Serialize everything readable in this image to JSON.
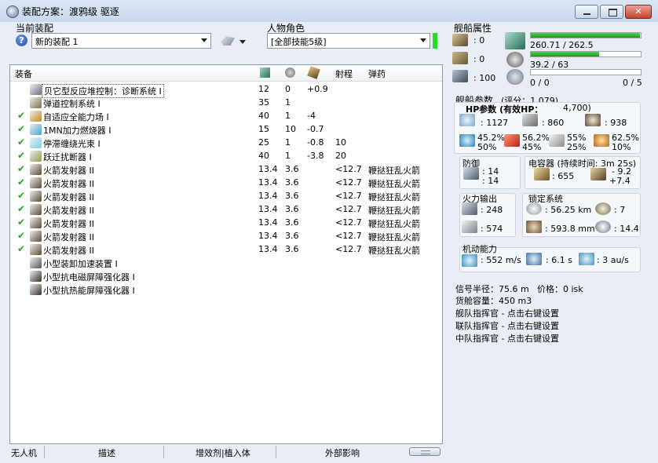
{
  "window": {
    "title": "装配方案：渡鸦级 驱逐"
  },
  "fitting_panel": {
    "label": "当前装配",
    "fit_select": "新的装配 1",
    "character_label": "人物角色",
    "character_select": "[全部技能5级]"
  },
  "module_list": {
    "headers": {
      "equip": "装备",
      "range": "射程",
      "ammo": "弹药"
    },
    "rows": [
      {
        "checked": false,
        "name": "贝它型反应堆控制：诊断系统 I",
        "c1": "12",
        "c2": "0",
        "c3": "+0.9",
        "range": "",
        "ammo": "",
        "icon": "#6e6e7e"
      },
      {
        "checked": false,
        "name": "弹道控制系统 I",
        "c1": "35",
        "c2": "1",
        "c3": "",
        "range": "",
        "ammo": "",
        "icon": "#7a6a4a"
      },
      {
        "checked": true,
        "name": "自适应全能力场 I",
        "c1": "40",
        "c2": "1",
        "c3": "-4",
        "range": "",
        "ammo": "",
        "icon": "#c4871e"
      },
      {
        "checked": true,
        "name": "1MN加力燃烧器 I",
        "c1": "15",
        "c2": "10",
        "c3": "-0.7",
        "range": "",
        "ammo": "",
        "icon": "#3fa7c9"
      },
      {
        "checked": true,
        "name": "停滞缠绕光束 I",
        "c1": "25",
        "c2": "1",
        "c3": "-0.8",
        "range": "10",
        "ammo": "",
        "icon": "#7fd0e8"
      },
      {
        "checked": true,
        "name": "跃迁扰断器 I",
        "c1": "40",
        "c2": "1",
        "c3": "-3.8",
        "range": "20",
        "ammo": "",
        "icon": "#8aa04a"
      },
      {
        "checked": true,
        "name": "火箭发射器 II",
        "c1": "13.4",
        "c2": "3.6",
        "c3": "",
        "range": "<12.7",
        "ammo": "鞭挞狂乱火箭",
        "icon": "#5a4a32"
      },
      {
        "checked": true,
        "name": "火箭发射器 II",
        "c1": "13.4",
        "c2": "3.6",
        "c3": "",
        "range": "<12.7",
        "ammo": "鞭挞狂乱火箭",
        "icon": "#5a4a32"
      },
      {
        "checked": true,
        "name": "火箭发射器 II",
        "c1": "13.4",
        "c2": "3.6",
        "c3": "",
        "range": "<12.7",
        "ammo": "鞭挞狂乱火箭",
        "icon": "#5a4a32"
      },
      {
        "checked": true,
        "name": "火箭发射器 II",
        "c1": "13.4",
        "c2": "3.6",
        "c3": "",
        "range": "<12.7",
        "ammo": "鞭挞狂乱火箭",
        "icon": "#5a4a32"
      },
      {
        "checked": true,
        "name": "火箭发射器 II",
        "c1": "13.4",
        "c2": "3.6",
        "c3": "",
        "range": "<12.7",
        "ammo": "鞭挞狂乱火箭",
        "icon": "#5a4a32"
      },
      {
        "checked": true,
        "name": "火箭发射器 II",
        "c1": "13.4",
        "c2": "3.6",
        "c3": "",
        "range": "<12.7",
        "ammo": "鞭挞狂乱火箭",
        "icon": "#5a4a32"
      },
      {
        "checked": true,
        "name": "火箭发射器 II",
        "c1": "13.4",
        "c2": "3.6",
        "c3": "",
        "range": "<12.7",
        "ammo": "鞭挞狂乱火箭",
        "icon": "#5a4a32"
      },
      {
        "checked": false,
        "name": "小型装卸加速装置 I",
        "c1": "",
        "c2": "",
        "c3": "",
        "range": "",
        "ammo": "",
        "icon": "#555555"
      },
      {
        "checked": false,
        "name": "小型抗电磁屏障强化器 I",
        "c1": "",
        "c2": "",
        "c3": "",
        "range": "",
        "ammo": "",
        "icon": "#3a3020"
      },
      {
        "checked": false,
        "name": "小型抗热能屏障强化器 I",
        "c1": "",
        "c2": "",
        "c3": "",
        "range": "",
        "ammo": "",
        "icon": "#3a3020"
      }
    ]
  },
  "status_bar": {
    "drones": "无人机",
    "description": "描述",
    "implants": "增效剂|植入体",
    "external": "外部影响"
  },
  "ship_attributes": {
    "label": "舰船属性",
    "hardpoints": {
      "turret": ": 0",
      "launcher": ": 0",
      "calibration": ": 100"
    },
    "cpu": {
      "text": "260.71 / 262.5",
      "fraction": 0.993
    },
    "power": {
      "text": "39.2 / 63",
      "fraction": 0.622
    },
    "drones_left": "0 / 0",
    "drones_right": "0 / 5"
  },
  "ship_params": {
    "label": "舰船参数",
    "score": "(评分：1,079)",
    "hp_label": "HP参数 (有效HP：",
    "hp_value": "4,700)",
    "shield_hp": ": 1127",
    "armor_hp": ": 860",
    "hull_hp": ": 938",
    "resists": {
      "em": [
        "45.2%",
        "50%"
      ],
      "thermal": [
        "56.2%",
        "45%"
      ],
      "kinetic": [
        "55%",
        "25%"
      ],
      "explosive": [
        "62.5%",
        "10%"
      ]
    }
  },
  "defense": {
    "label": "防御",
    "v1": ": 14",
    "v2": ": 14"
  },
  "capacitor": {
    "label": "电容器 (持续时间: 3m 25s)",
    "amount": ": 655",
    "delta1": "- 9.2",
    "delta2": "+7.4"
  },
  "firepower": {
    "label": "火力输出",
    "dps": ": 248",
    "volley": ": 574"
  },
  "targeting": {
    "label": "锁定系统",
    "range": ": 56.25 km",
    "targets": ": 7",
    "resolution": ": 593.8 mm",
    "sensor": ": 14.4"
  },
  "mobility": {
    "label": "机动能力",
    "speed": ": 552 m/s",
    "align": ": 6.1 s",
    "warp": ": 3 au/s"
  },
  "misc": {
    "signature": "信号半径：75.6 m",
    "price": "价格：0 isk",
    "cargo": "货舱容量：450 m3",
    "fleet_booster": "舰队指挥官 - 点击右键设置",
    "wing_booster": "联队指挥官 - 点击右键设置",
    "squad_booster": "中队指挥官 - 点击右键设置"
  }
}
